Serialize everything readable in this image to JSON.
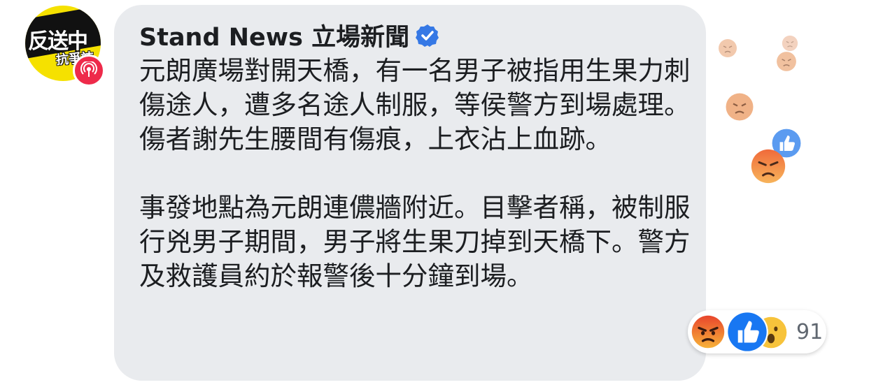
{
  "avatar": {
    "line1": "反送中",
    "line2": "抗爭誌",
    "badge_icon": "live-broadcast-icon"
  },
  "post": {
    "author": "Stand News 立場新聞",
    "verified_icon": "verified-check-icon",
    "paragraphs": [
      "元朗廣場對開天橋，有一名男子被指用生果力刺傷途人，遭多名途人制服，等侯警方到場處理。傷者謝先生腰間有傷痕，上衣沾上血跡。",
      "事發地點為元朗連儂牆附近。目擊者稱，被制服行兇男子期間，男子將生果刀掉到天橋下。警方及救護員約於報警後十分鐘到場。"
    ]
  },
  "reactions": {
    "count": "91",
    "types": [
      "angry",
      "like",
      "wow"
    ],
    "colors": {
      "angry": "#f0803a",
      "like": "#1877f2",
      "wow": "#f7c33b"
    }
  }
}
